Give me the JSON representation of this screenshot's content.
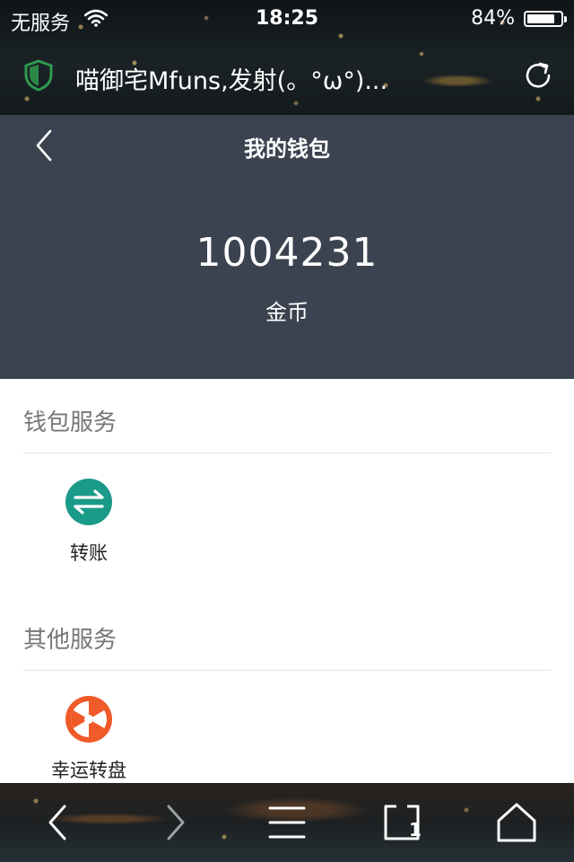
{
  "status_bar": {
    "carrier": "无服务",
    "time": "18:25",
    "battery_percent": "84%",
    "battery_level": 0.84
  },
  "browser": {
    "page_title": "喵御宅Mfuns,发射(。°ω°)..."
  },
  "wallet": {
    "title": "我的钱包",
    "balance": "1004231",
    "currency": "金币"
  },
  "sections": {
    "wallet_services": {
      "title": "钱包服务",
      "items": [
        {
          "label": "转账",
          "icon": "transfer-icon",
          "color": "#1a9a88"
        }
      ]
    },
    "other_services": {
      "title": "其他服务",
      "items": [
        {
          "label": "幸运转盘",
          "icon": "lucky-wheel-icon",
          "color": "#f05a28"
        }
      ]
    }
  },
  "toolbar": {
    "icons": [
      "back-icon",
      "forward-icon",
      "menu-icon",
      "tabs-icon",
      "home-icon"
    ],
    "tab_count": "1"
  },
  "colors": {
    "header_bg": "#3c4350",
    "shield": "#2e9a4f",
    "transfer": "#1a9a88",
    "wheel": "#f05a28"
  }
}
